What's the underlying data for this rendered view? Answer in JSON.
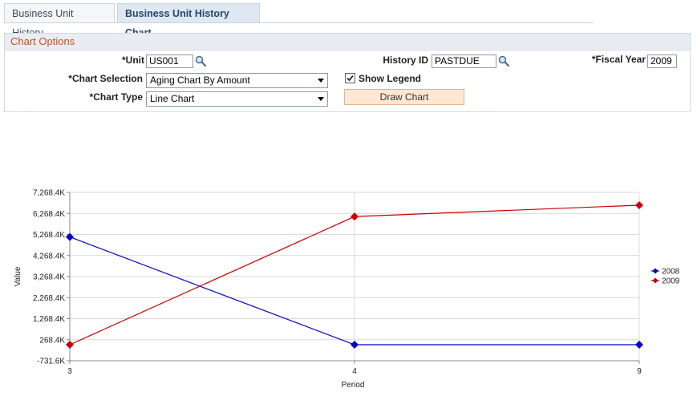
{
  "tabs": [
    {
      "label_pre": "Business Unit ",
      "label_ul": "H",
      "label_post": "istory"
    },
    {
      "label": "Business Unit History Chart"
    }
  ],
  "panel": {
    "title": "Chart Options",
    "unit": {
      "label": "*Unit",
      "value": "US001"
    },
    "history_id": {
      "label": "History ID",
      "value": "PASTDUE"
    },
    "fiscal_year": {
      "label": "*Fiscal Year",
      "value": "2009"
    },
    "chart_selection": {
      "label": "*Chart Selection",
      "value": "Aging Chart By Amount"
    },
    "show_legend": {
      "label": "Show Legend",
      "checked": true
    },
    "chart_type": {
      "label": "*Chart Type",
      "value": "Line Chart"
    },
    "draw_button": "Draw Chart"
  },
  "colors": {
    "series_2008": "#0000cc",
    "series_2009": "#cc0000"
  },
  "chart_data": {
    "type": "line",
    "title": "",
    "xlabel": "Period",
    "ylabel": "Value",
    "categories": [
      "3",
      "4",
      "9"
    ],
    "y_ticks": [
      "-731.6K",
      "268.4K",
      "1,268.4K",
      "2,268.4K",
      "3,268.4K",
      "4,268.4K",
      "5,268.4K",
      "6,268.4K",
      "7,268.4K"
    ],
    "ylim": [
      -731.6,
      7268.4
    ],
    "grid": true,
    "legend_position": "right",
    "series": [
      {
        "name": "2008",
        "values": [
          5150,
          30,
          30
        ]
      },
      {
        "name": "2009",
        "values": [
          30,
          6120,
          6660
        ]
      }
    ]
  }
}
